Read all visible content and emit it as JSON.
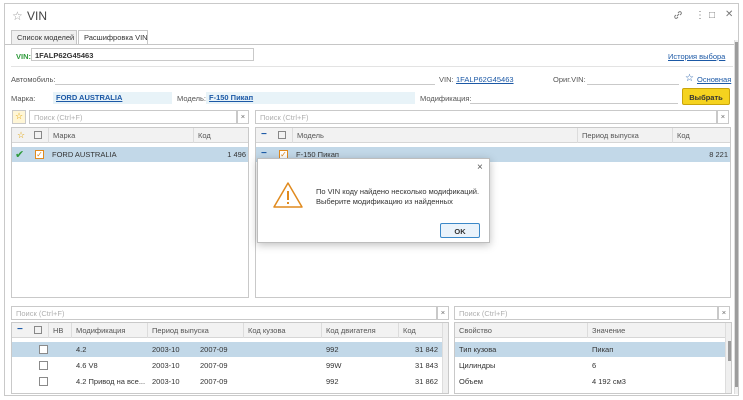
{
  "window": {
    "title": "VIN"
  },
  "tabs": [
    {
      "label": "Список моделей"
    },
    {
      "label": "Расшифровка VIN"
    }
  ],
  "vin_bar": {
    "label": "VIN:",
    "value": "1FALP62G45463",
    "history_link": "История выбора"
  },
  "info": {
    "car_label": "Автомобиль:",
    "vin_label": "VIN:",
    "vin_value": "1FALP62G45463",
    "orig_vin_label": "Ориг.VIN:",
    "main_link": "Основная",
    "brand_label": "Марка:",
    "brand_value": "FORD AUSTRALIA",
    "model_label": "Модель:",
    "model_value": "F-150 Пикап",
    "mod_label": "Модификация:",
    "choose_button": "Выбрать"
  },
  "brands": {
    "search_placeholder": "Поиск (Ctrl+F)",
    "columns": [
      "Марка",
      "Код"
    ],
    "rows": [
      {
        "name": "FORD AUSTRALIA",
        "code": "1 496"
      }
    ]
  },
  "models": {
    "search_placeholder": "Поиск (Ctrl+F)",
    "columns": [
      "Модель",
      "Период выпуска",
      "Код"
    ],
    "rows": [
      {
        "name": "F-150 Пикап",
        "period": "",
        "code": "8 221"
      }
    ]
  },
  "modifications": {
    "search_placeholder": "Поиск (Ctrl+F)",
    "columns": [
      "НВ",
      "Модификация",
      "Период выпуска",
      "Код кузова",
      "Код двигателя",
      "Код"
    ],
    "rows": [
      {
        "name": "4.2",
        "from": "2003-10",
        "to": "2007-09",
        "body": "",
        "engine": "992",
        "code": "31 842"
      },
      {
        "name": "4.6 V8",
        "from": "2003-10",
        "to": "2007-09",
        "body": "",
        "engine": "99W",
        "code": "31 843"
      },
      {
        "name": "4.2 Привод на все...",
        "from": "2003-10",
        "to": "2007-09",
        "body": "",
        "engine": "992",
        "code": "31 862"
      }
    ]
  },
  "properties": {
    "search_placeholder": "Поиск (Ctrl+F)",
    "columns": [
      "Свойство",
      "Значение"
    ],
    "rows": [
      {
        "prop": "Тип кузова",
        "value": "Пикап"
      },
      {
        "prop": "Цилиндры",
        "value": "6"
      },
      {
        "prop": "Объем",
        "value": "4 192 см3"
      }
    ]
  },
  "dialog": {
    "message_line1": "По VIN коду найдено несколько модификаций.",
    "message_line2": "Выберите модификацию из найденных",
    "ok_button": "OK"
  },
  "colors": {
    "accent_yellow": "#f5d31f",
    "selected_row": "#c2d8e8",
    "link": "#1c59a6",
    "vin_green": "#2e9a3a",
    "warning_orange": "#e08a1e"
  },
  "icons": [
    "star-icon",
    "link-icon",
    "more-icon",
    "maximize-icon",
    "close-icon",
    "clear-icon",
    "checkbox-icon",
    "checkmark-icon",
    "collapse-icon",
    "warning-icon"
  ]
}
